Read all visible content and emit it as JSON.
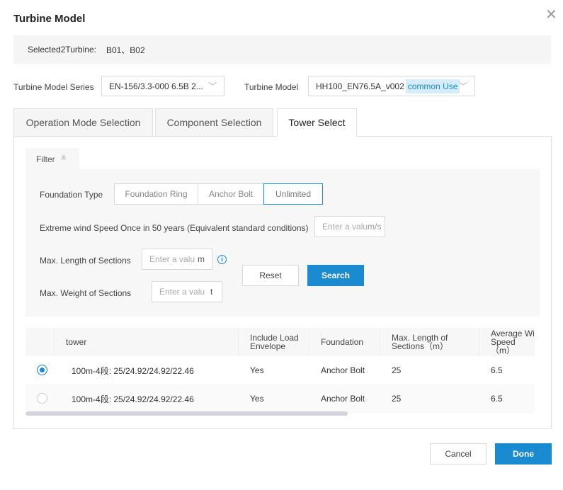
{
  "dialog": {
    "title": "Turbine Model",
    "close_icon": "close-icon"
  },
  "selected": {
    "label": "Selected2Turbine:",
    "value": "B01、B02"
  },
  "series": {
    "label": "Turbine Model Series",
    "value": "EN-156/3.3-000 6.5B 2..."
  },
  "model": {
    "label": "Turbine Model",
    "value": "HH100_EN76.5A_v002",
    "tag": "common Use"
  },
  "tabs": [
    {
      "label": "Operation Mode Selection"
    },
    {
      "label": "Component Selection"
    },
    {
      "label": "Tower Select",
      "active": true
    }
  ],
  "filter": {
    "label": "Filter",
    "foundation_label": "Foundation Type",
    "foundation_options": [
      "Foundation Ring",
      "Anchor Bolt",
      "Unlimited"
    ],
    "foundation_selected": "Unlimited",
    "wind_label": "Extreme wind Speed Once in 50 years (Equivalent standard conditions)",
    "wind_placeholder": "Enter a valu",
    "wind_unit": "m/s",
    "length_label": "Max. Length of Sections",
    "length_placeholder": "Enter a valu",
    "length_unit": "m",
    "weight_label": "Max. Weight of Sections",
    "weight_placeholder": "Enter a valu",
    "weight_unit": "t",
    "reset": "Reset",
    "search": "Search"
  },
  "table": {
    "columns": [
      "tower",
      "Include Load Envelope",
      "Foundation",
      "Max. Length of Sections（m）",
      "Average Wi Speed（m）"
    ],
    "rows": [
      {
        "selected": true,
        "cells": [
          "100m-4段: 25/24.92/24.92/22.46",
          "Yes",
          "Anchor Bolt",
          "25",
          "6.5"
        ]
      },
      {
        "selected": false,
        "cells": [
          "100m-4段: 25/24.92/24.92/22.46",
          "Yes",
          "Anchor Bolt",
          "25",
          "6.5"
        ]
      }
    ]
  },
  "footer": {
    "cancel": "Cancel",
    "done": "Done"
  },
  "colors": {
    "accent": "#1a8bd0"
  }
}
